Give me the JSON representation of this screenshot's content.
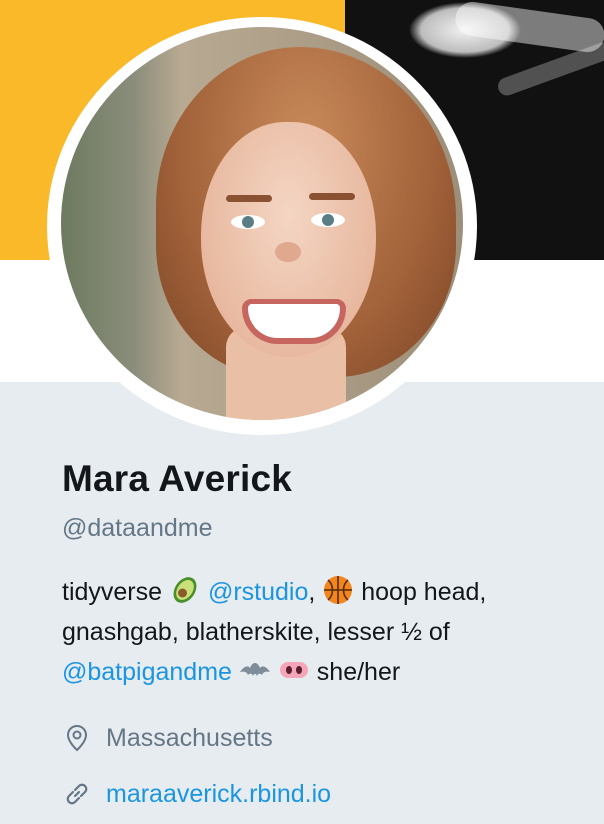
{
  "profile": {
    "name": "Mara Averick",
    "handle": "@dataandme",
    "bio": {
      "line1_text1": "tidyverse",
      "line1_emoji1": "avocado-icon",
      "line1_link": "@rstudio",
      "line1_text2": ",",
      "line1_emoji2": "basketball-icon",
      "line1_text3": "hoop head,",
      "line2": "gnashgab, blatherskite, lesser ½ of",
      "line3_link": "@batpigandme",
      "line3_emoji1": "bat-icon",
      "line3_emoji2": "pig-nose-icon",
      "line3_text": "she/her"
    },
    "location": "Massachusetts",
    "website": "maraaverick.rbind.io"
  },
  "icons": {
    "location": "location-pin-icon",
    "website": "link-icon"
  },
  "colors": {
    "banner_accent": "#f9b928",
    "link": "#1b95e0",
    "secondary_text": "#657786",
    "primary_text": "#14171a",
    "background": "#e6ecf0"
  }
}
